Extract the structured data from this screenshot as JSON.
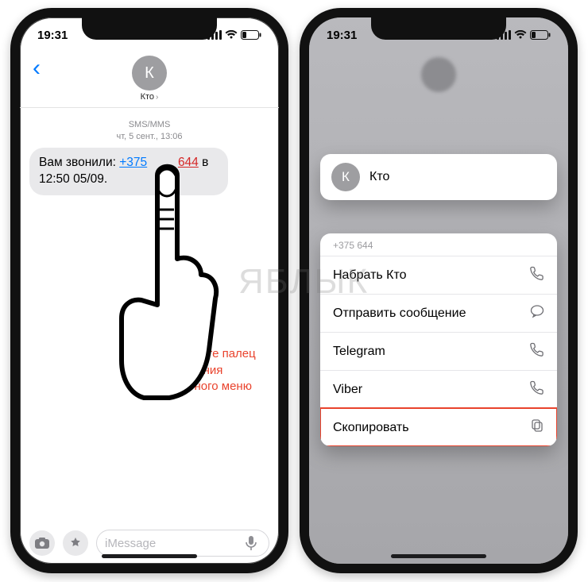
{
  "status": {
    "time": "19:31"
  },
  "left": {
    "contact": {
      "initial": "К",
      "name": "Кто"
    },
    "meta_type": "SMS/MMS",
    "meta_date": "чт, 5 сент., 13:06",
    "bubble": {
      "prefix": "Вам звонили: ",
      "link_blue": "+375",
      "link_red": "644",
      "suffix": " в 12:50 05/09."
    },
    "hint": "Нажмите и удерживайте палец до появления контекстного меню",
    "input_placeholder": "iMessage"
  },
  "right": {
    "contact": {
      "initial": "К",
      "name": "Кто"
    },
    "menu_header": "+375            644",
    "menu": [
      {
        "label": "Набрать Кто",
        "icon": "phone"
      },
      {
        "label": "Отправить сообщение",
        "icon": "message"
      },
      {
        "label": "Telegram",
        "icon": "phone"
      },
      {
        "label": "Viber",
        "icon": "phone"
      },
      {
        "label": "Скопировать",
        "icon": "copy",
        "highlight": true
      }
    ]
  },
  "watermark": "ЯБЛЫК"
}
